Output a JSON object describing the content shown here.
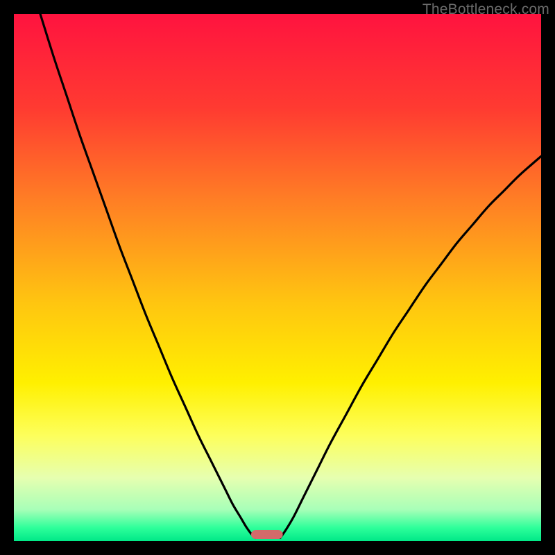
{
  "watermark": "TheBottleneck.com",
  "chart_data": {
    "type": "line",
    "title": "",
    "xlabel": "",
    "ylabel": "",
    "xlim": [
      0,
      100
    ],
    "ylim": [
      0,
      100
    ],
    "gradient_stops": [
      {
        "offset": 0.0,
        "color": "#ff133f"
      },
      {
        "offset": 0.18,
        "color": "#ff3b31"
      },
      {
        "offset": 0.35,
        "color": "#ff7d25"
      },
      {
        "offset": 0.55,
        "color": "#ffc610"
      },
      {
        "offset": 0.7,
        "color": "#fff000"
      },
      {
        "offset": 0.8,
        "color": "#fdff5c"
      },
      {
        "offset": 0.88,
        "color": "#e6ffb0"
      },
      {
        "offset": 0.94,
        "color": "#a8ffb8"
      },
      {
        "offset": 0.975,
        "color": "#2dff9a"
      },
      {
        "offset": 1.0,
        "color": "#00e888"
      }
    ],
    "series": [
      {
        "name": "left-curve",
        "x": [
          5.0,
          7.5,
          10.0,
          12.5,
          15.0,
          17.5,
          20.0,
          22.5,
          25.0,
          27.5,
          30.0,
          32.5,
          35.0,
          37.5,
          40.0,
          41.5,
          43.0,
          44.0,
          45.0,
          45.8
        ],
        "y": [
          100.0,
          92.0,
          84.5,
          77.0,
          70.0,
          63.0,
          56.0,
          49.5,
          43.0,
          37.0,
          31.0,
          25.5,
          20.0,
          15.0,
          10.0,
          7.0,
          4.5,
          2.8,
          1.4,
          0.6
        ]
      },
      {
        "name": "right-curve",
        "x": [
          50.5,
          51.5,
          53.0,
          55.0,
          57.5,
          60.0,
          63.0,
          66.0,
          69.0,
          72.0,
          75.0,
          78.0,
          81.0,
          84.0,
          87.0,
          90.0,
          93.0,
          96.0,
          100.0
        ],
        "y": [
          0.6,
          2.0,
          4.5,
          8.5,
          13.5,
          18.5,
          24.0,
          29.5,
          34.5,
          39.5,
          44.0,
          48.5,
          52.5,
          56.5,
          60.0,
          63.5,
          66.5,
          69.5,
          73.0
        ]
      }
    ],
    "marker": {
      "name": "bottleneck-marker",
      "x_center": 48.0,
      "width": 6.0,
      "color": "#d46a6a"
    }
  }
}
